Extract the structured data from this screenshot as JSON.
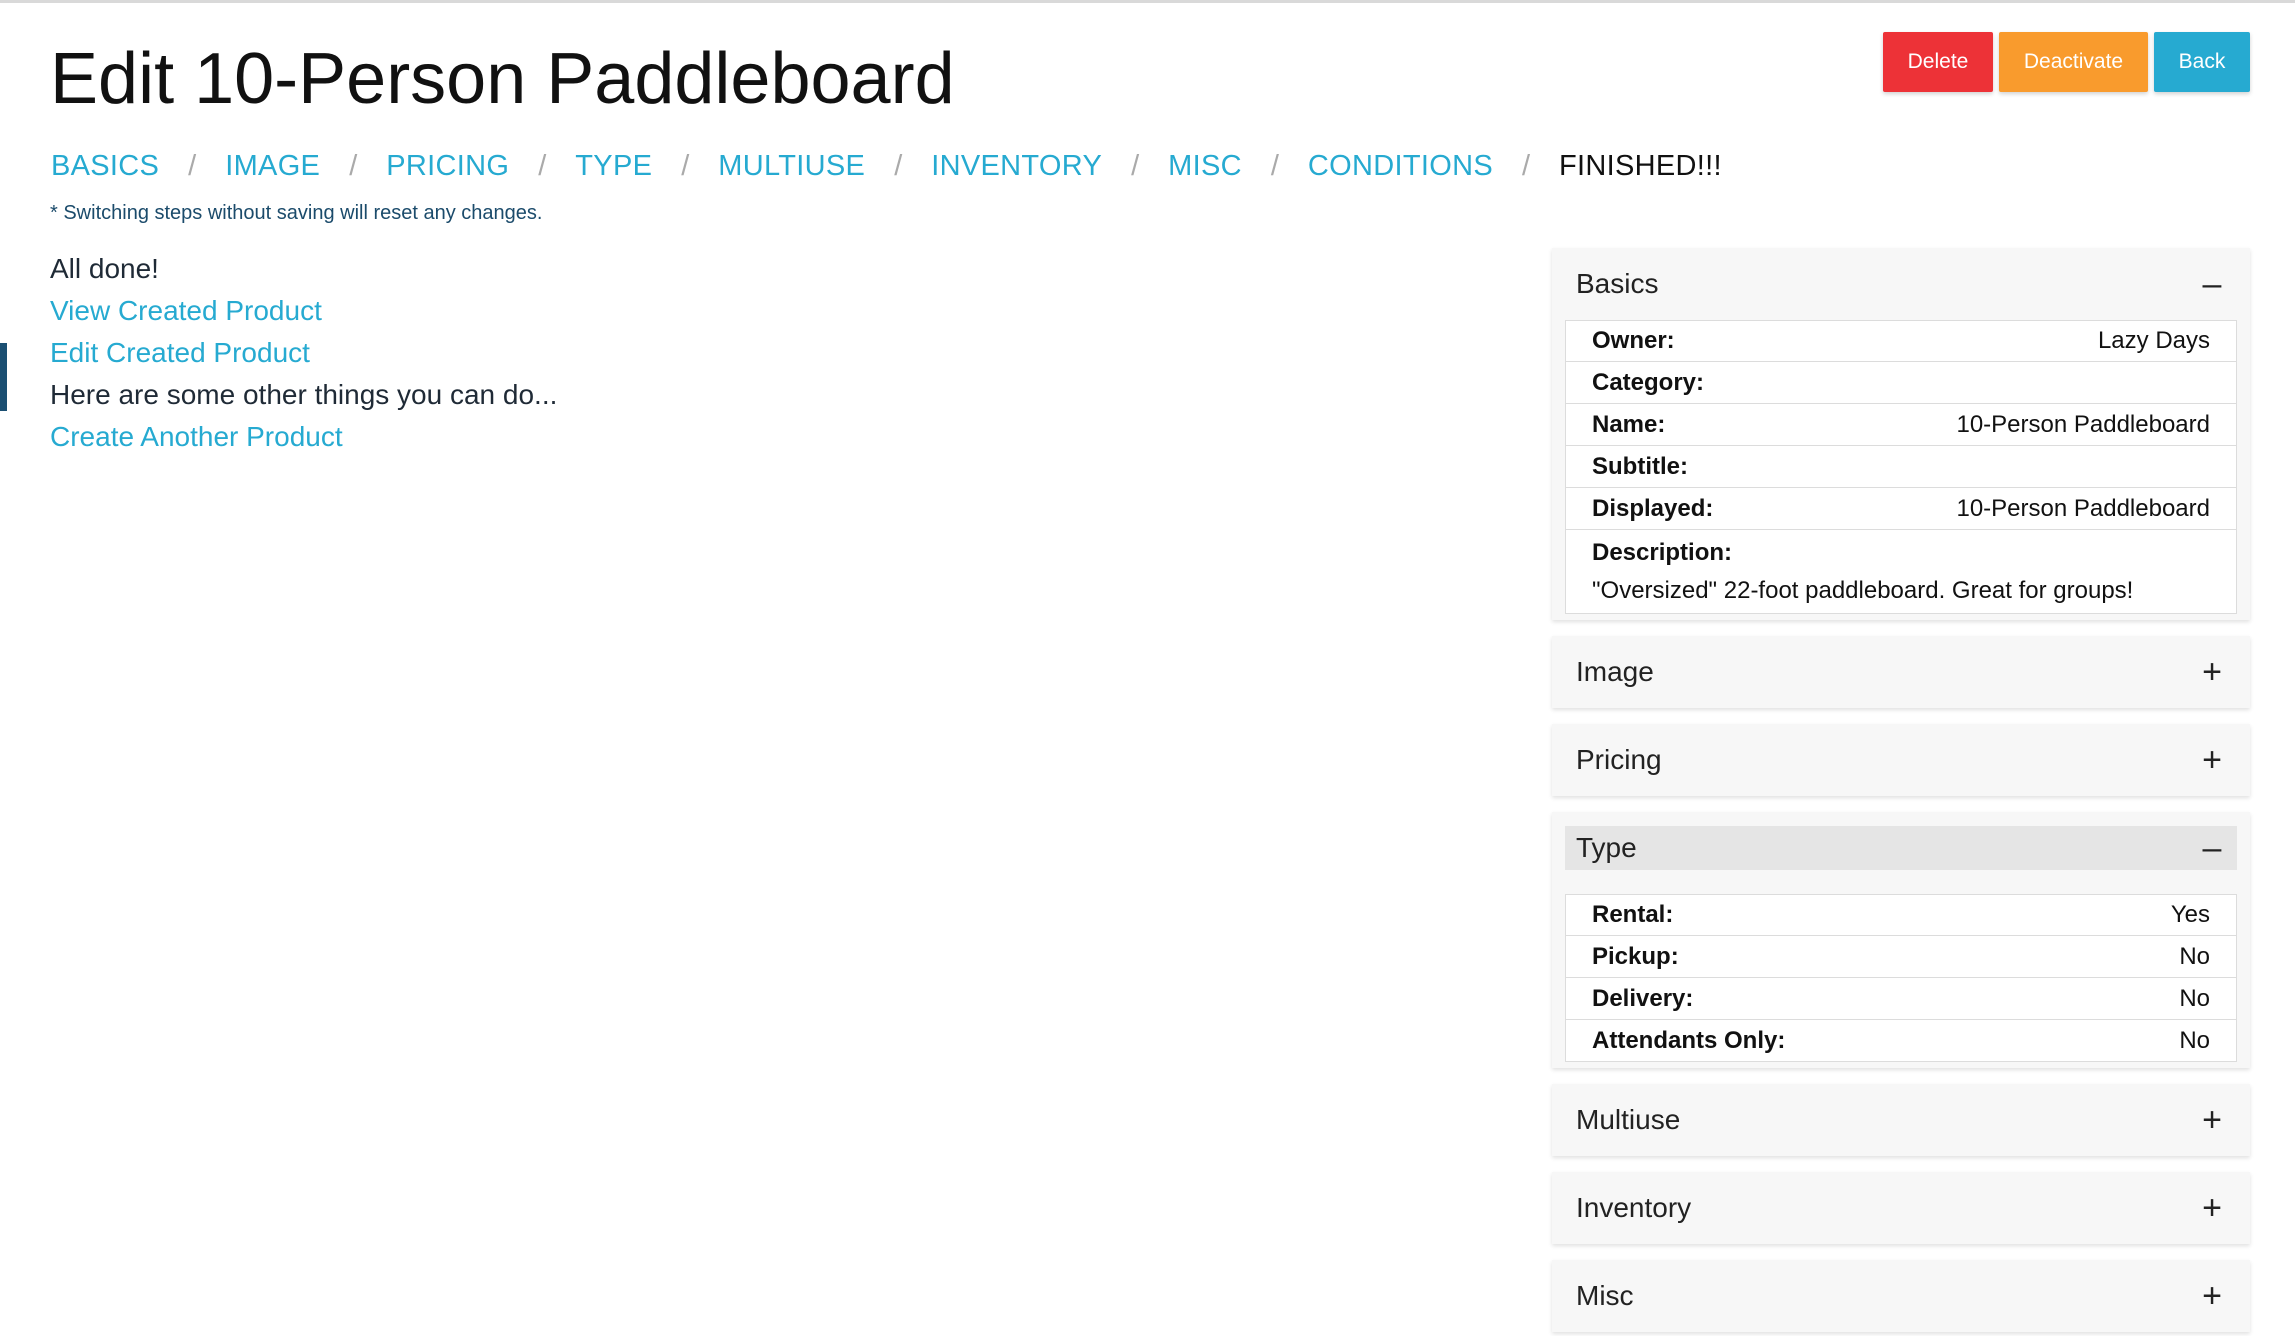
{
  "page": {
    "title": "Edit 10-Person Paddleboard"
  },
  "actions": {
    "delete": "Delete",
    "deactivate": "Deactivate",
    "back": "Back"
  },
  "steps": {
    "items": [
      "BASICS",
      "IMAGE",
      "PRICING",
      "TYPE",
      "MULTIUSE",
      "INVENTORY",
      "MISC",
      "CONDITIONS"
    ],
    "current": "FINISHED!!!",
    "separator": "/"
  },
  "note": "* Switching steps without saving will reset any changes.",
  "finished": {
    "done_text": "All done!",
    "view_link": "View Created Product",
    "edit_link": "Edit Created Product",
    "other_text": "Here are some other things you can do...",
    "create_link": "Create Another Product"
  },
  "summary": {
    "basics": {
      "title": "Basics",
      "toggle": "–",
      "owner_label": "Owner:",
      "owner_value": "Lazy Days",
      "category_label": "Category:",
      "category_value": "",
      "name_label": "Name:",
      "name_value": "10-Person Paddleboard",
      "subtitle_label": "Subtitle:",
      "subtitle_value": "",
      "displayed_label": "Displayed:",
      "displayed_value": "10-Person Paddleboard",
      "description_label": "Description:",
      "description_value": "\"Oversized\" 22-foot paddleboard. Great for groups!"
    },
    "image": {
      "title": "Image",
      "toggle": "+"
    },
    "pricing": {
      "title": "Pricing",
      "toggle": "+"
    },
    "type": {
      "title": "Type",
      "toggle": "–",
      "rental_label": "Rental:",
      "rental_value": "Yes",
      "pickup_label": "Pickup:",
      "pickup_value": "No",
      "delivery_label": "Delivery:",
      "delivery_value": "No",
      "attendants_label": "Attendants Only:",
      "attendants_value": "No"
    },
    "multiuse": {
      "title": "Multiuse",
      "toggle": "+"
    },
    "inventory": {
      "title": "Inventory",
      "toggle": "+"
    },
    "misc": {
      "title": "Misc",
      "toggle": "+"
    }
  }
}
